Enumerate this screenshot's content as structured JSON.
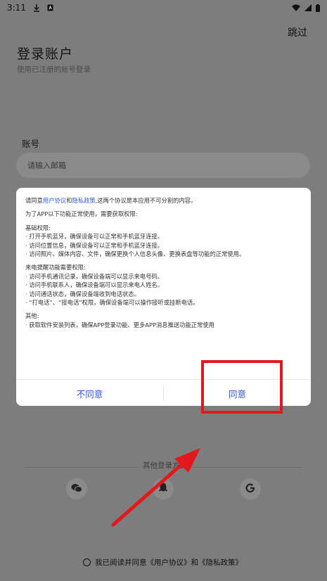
{
  "status_bar": {
    "time": "3:11"
  },
  "header": {
    "skip_label": "跳过",
    "title": "登录账户",
    "subtitle": "使用已注册的账号登录"
  },
  "form": {
    "account_label": "账号",
    "account_placeholder": "请输入邮箱"
  },
  "other_login": {
    "label": "其他登录方式"
  },
  "agreement": {
    "text": "我已阅读并同意《用户协议》和《隐私政策》"
  },
  "dialog": {
    "intro_pre": "请同意",
    "user_agreement": "用户协议",
    "intro_and": "和",
    "privacy_policy": "隐私政策",
    "intro_post": ",这两个协议是本应用不可分割的内容。",
    "permissions_intro": "为了APP以下功能正常使用，需要获取权限:",
    "basic_title": "基础权限:",
    "basic_items": [
      "· 打开手机蓝牙，确保设备可以正常和手机蓝牙连接。",
      "· 访问位置信息，确保设备可以正常和手机蓝牙连接。",
      "· 访问照片、媒体内容、文件，确保更换个人信息头像、更换表盘等功能的正常使用。"
    ],
    "call_title": "来电提醒功能需要权限:",
    "call_items": [
      "· 访问手机通讯记录，确保设备端可以显示来电号码。",
      "· 访问手机联系人，确保设备端可以显示来电人姓名。",
      "· 访问通话状态，确保设备端收到电话状态。",
      "· “打电话”、“接电话”权限，确保设备端可以操作接听或挂断电话。"
    ],
    "other_title": "其他:",
    "other_items": [
      "· 获取软件安装列表，确保APP登录功能、更多APP消息推送功能正常使用"
    ],
    "disagree_label": "不同意",
    "agree_label": "同意"
  },
  "colors": {
    "overlay": "#7d7d7d",
    "link": "#2f5be7",
    "button": "#3155d8",
    "highlight": "#e3181c"
  },
  "icons": [
    "download-icon",
    "sim-icon",
    "wifi-icon",
    "signal-icon",
    "battery-icon",
    "wechat-icon",
    "qq-icon",
    "google-icon"
  ]
}
